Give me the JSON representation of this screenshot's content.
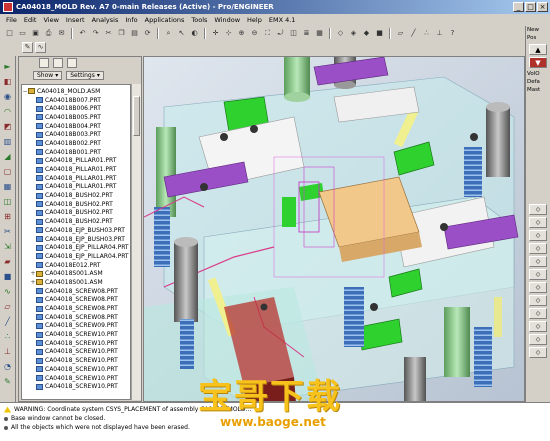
{
  "window": {
    "title": "CA04018_MOLD Rev. A7 0-main Releases (Active) - Pro/ENGINEER",
    "controls": [
      "_",
      "□",
      "×"
    ]
  },
  "menu": [
    "File",
    "Edit",
    "View",
    "Insert",
    "Analysis",
    "Info",
    "Applications",
    "Tools",
    "Window",
    "Help",
    "EMX 4.1"
  ],
  "toolbar_icons": [
    "new-icon",
    "open-icon",
    "save-icon",
    "print-icon",
    "email-icon",
    "undo-icon",
    "redo-icon",
    "cut-icon",
    "copy-icon",
    "paste-icon",
    "regenerate-icon",
    "find-icon",
    "select-icon",
    "repaint-icon",
    "spin-center-icon",
    "orient-icon",
    "zoom-in-icon",
    "zoom-out-icon",
    "refit-icon",
    "reorient-icon",
    "saved-views-icon",
    "layers-icon",
    "view-manager-icon",
    "wireframe-icon",
    "hidden-line-icon",
    "no-hidden-icon",
    "shading-icon",
    "datum-planes-icon",
    "datum-axes-icon",
    "datum-points-icon",
    "coord-sys-icon",
    "context-help-icon"
  ],
  "tree": {
    "show_label": "Show",
    "settings_label": "Settings",
    "root": "CA04018_MOLD.ASM",
    "items": [
      "CA04018B007.PRT",
      "CA04018B006.PRT",
      "CA04018B005.PRT",
      "CA04018B004.PRT",
      "CA04018B003.PRT",
      "CA04018B002.PRT",
      "CA04018B001.PRT",
      "CA04018_PILLAR01.PRT",
      "CA04018_PILLAR01.PRT",
      "CA04018_PILLAR01.PRT",
      "CA04018_PILLAR01.PRT",
      "CA04018_BUSH02.PRT",
      "CA04018_BUSH02.PRT",
      "CA04018_BUSH02.PRT",
      "CA04018_BUSH02.PRT",
      "CA04018_EJP_BUSH03.PRT",
      "CA04018_EJP_BUSH03.PRT",
      "CA04018_EJP_PILLAR04.PRT",
      "CA04018_EJP_PILLAR04.PRT",
      "CA04018E012.PRT",
      "CA04018S001.ASM",
      "CA04018S001.ASM",
      "CA04018_SCREW08.PRT",
      "CA04018_SCREW08.PRT",
      "CA04018_SCREW08.PRT",
      "CA04018_SCREW08.PRT",
      "CA04018_SCREW09.PRT",
      "CA04018_SCREW10.PRT",
      "CA04018_SCREW10.PRT",
      "CA04018_SCREW10.PRT",
      "CA04018_SCREW10.PRT",
      "CA04018_SCREW10.PRT",
      "CA04018_SCREW10.PRT",
      "CA04018_SCREW10.PRT"
    ]
  },
  "right_panel": {
    "labels": [
      "New",
      "Pos",
      "VolO",
      "Defa",
      "Mast"
    ],
    "buttons": [
      "▲",
      "▼"
    ]
  },
  "messages": [
    "WARNING: Coordinate system CSYS_PLACEMENT of assembly CA04018MOLD...",
    "Base window cannot be closed.",
    "All the objects which were not displayed have been erased."
  ],
  "watermark": {
    "text": "宝哥下载",
    "url": "www.baoge.net"
  },
  "colors": {
    "plate": "#bfe3e3",
    "green_block": "#2fd12f",
    "purple_clamp": "#9b4fc7",
    "core": "#f2c78a",
    "pillar_green": "#8fd18f",
    "pillar_grey": "#9a9a9a",
    "spring_blue": "#4a7cc7"
  }
}
